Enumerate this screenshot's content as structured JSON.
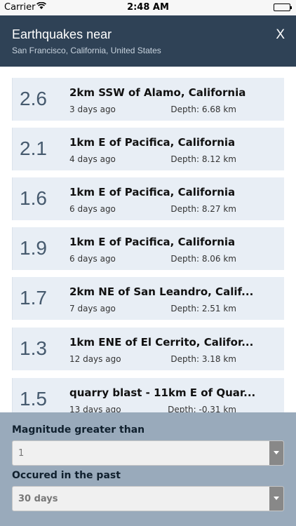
{
  "status": {
    "carrier": "Carrier",
    "time": "2:48 AM"
  },
  "header": {
    "title": "Earthquakes near",
    "subtitle": "San Francisco, California, United States",
    "close_label": "X"
  },
  "quakes": [
    {
      "magnitude": "2.6",
      "place": "2km SSW of Alamo, California",
      "ago": "3 days ago",
      "depth": "Depth: 6.68 km"
    },
    {
      "magnitude": "2.1",
      "place": "1km E of Pacifica, California",
      "ago": "4 days ago",
      "depth": "Depth: 8.12 km"
    },
    {
      "magnitude": "1.6",
      "place": "1km E of Pacifica, California",
      "ago": "6 days ago",
      "depth": "Depth: 8.27 km"
    },
    {
      "magnitude": "1.9",
      "place": "1km E of Pacifica, California",
      "ago": "6 days ago",
      "depth": "Depth: 8.06 km"
    },
    {
      "magnitude": "1.7",
      "place": "2km NE of San Leandro, Calif...",
      "ago": "7 days ago",
      "depth": "Depth: 2.51 km"
    },
    {
      "magnitude": "1.3",
      "place": "1km ENE of El Cerrito, Califor...",
      "ago": "12 days ago",
      "depth": "Depth: 3.18 km"
    },
    {
      "magnitude": "1.5",
      "place": "quarry blast - 11km E of Quar...",
      "ago": "13 days ago",
      "depth": "Depth: -0.31 km"
    }
  ],
  "filters": {
    "magnitude_label": "Magnitude greater than",
    "magnitude_value": "1",
    "period_label": "Occured in the past",
    "period_value": "30 days"
  }
}
